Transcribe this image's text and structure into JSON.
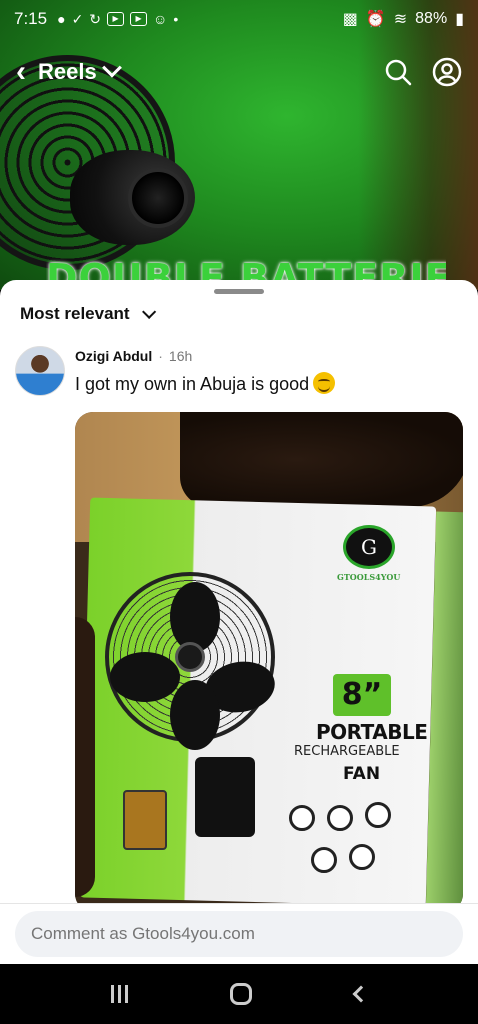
{
  "status_bar": {
    "time": "7:15",
    "battery": "88%"
  },
  "header": {
    "back_icon": "chevron-left-icon",
    "title": "Reels",
    "search_icon": "search-icon",
    "profile_icon": "account-icon"
  },
  "video": {
    "banner_text": "DOUBLE BATTERIES"
  },
  "comments": {
    "sort_label": "Most relevant",
    "items": [
      {
        "author": "Ozigi Abdul",
        "time": "16h",
        "text": "I got my own in Abuja is good",
        "emoji": "smiling-face-icon"
      }
    ]
  },
  "product_box": {
    "size": "8”",
    "title": "PORTABLE",
    "subtitle": "RECHARGEABLE",
    "product": "FAN"
  },
  "comment_input": {
    "placeholder": "Comment as Gtools4you.com"
  },
  "colors": {
    "accent_green": "#3bd13b",
    "input_bg": "#f0f2f5"
  }
}
